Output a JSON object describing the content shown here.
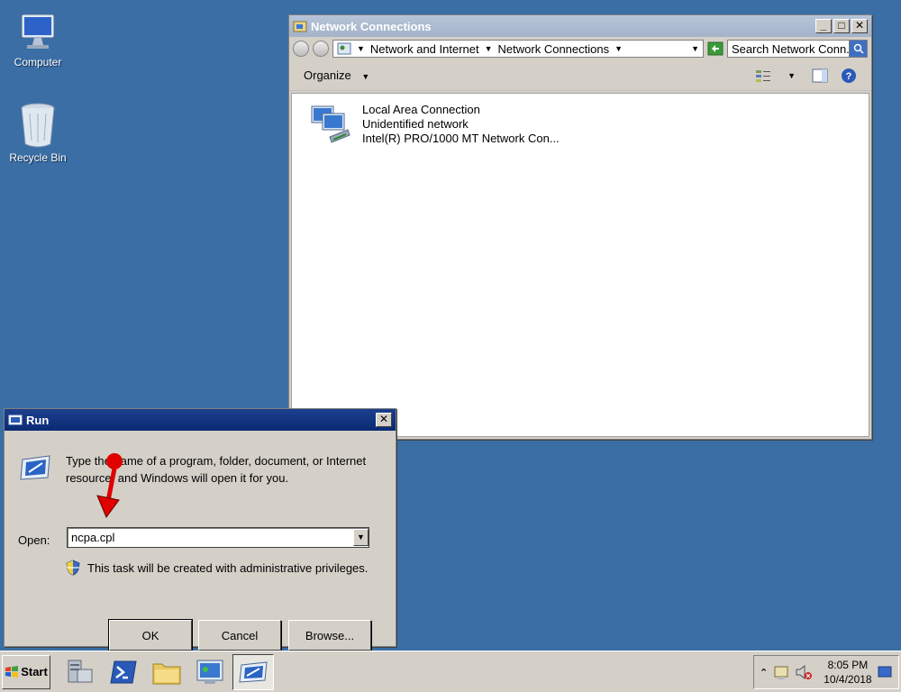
{
  "desktop": {
    "icons": [
      {
        "label": "Computer"
      },
      {
        "label": "Recycle Bin"
      }
    ]
  },
  "net_window": {
    "title": "Network Connections",
    "breadcrumbs": [
      "Network and Internet",
      "Network Connections"
    ],
    "search_placeholder": "Search Network Conn...",
    "organize_label": "Organize",
    "connection": {
      "name": "Local Area Connection",
      "status": "Unidentified network",
      "adapter": "Intel(R) PRO/1000 MT Network Con..."
    }
  },
  "run_dialog": {
    "title": "Run",
    "description": "Type the name of a program, folder, document, or Internet resource, and Windows will open it for you.",
    "open_label": "Open:",
    "open_value": "ncpa.cpl",
    "privilege_text": "This task will be created with administrative privileges.",
    "ok_label": "OK",
    "cancel_label": "Cancel",
    "browse_label": "Browse..."
  },
  "taskbar": {
    "start_label": "Start",
    "time": "8:05 PM",
    "date": "10/4/2018"
  },
  "colors": {
    "desktop": "#3a6ea5",
    "annotation": "#e00000"
  }
}
